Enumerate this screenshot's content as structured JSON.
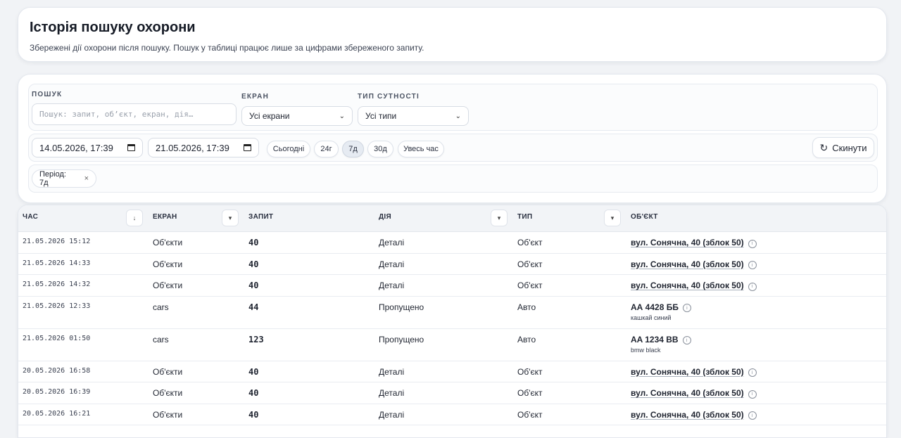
{
  "header": {
    "title": "Історія пошуку охорони",
    "subtitle": "Збережені дії охорони після пошуку. Пошук у таблиці працює лише за цифрами збереженого запиту."
  },
  "filters": {
    "search_label": "ПОШУК",
    "search_placeholder": "Пошук: запит, об’єкт, екран, дія…",
    "screen_label": "ЕКРАН",
    "screen_value": "Усі екрани",
    "type_label": "ТИП СУТНОСТІ",
    "type_value": "Усі типи",
    "date_from": "14.05.2026, 17:39",
    "date_to": "21.05.2026, 17:39",
    "chips": [
      "Сьогодні",
      "24г",
      "7д",
      "30д",
      "Увесь час"
    ],
    "active_chip": "7д",
    "reset_label": "Скинути",
    "period_chip": "Період: 7д"
  },
  "table": {
    "columns": [
      "ЧАС",
      "ЕКРАН",
      "ЗАПИТ",
      "ДІЯ",
      "ТИП",
      "ОБ'ЄКТ"
    ],
    "rows": [
      {
        "time": "21.05.2026 15:12",
        "screen": "Об'єкти",
        "query": "40",
        "action": "Деталі",
        "type": "Об'єкт",
        "object": "вул. Сонячна, 40 (зблок 50)",
        "sub": ""
      },
      {
        "time": "21.05.2026 14:33",
        "screen": "Об'єкти",
        "query": "40",
        "action": "Деталі",
        "type": "Об'єкт",
        "object": "вул. Сонячна, 40 (зблок 50)",
        "sub": ""
      },
      {
        "time": "21.05.2026 14:32",
        "screen": "Об'єкти",
        "query": "40",
        "action": "Деталі",
        "type": "Об'єкт",
        "object": "вул. Сонячна, 40 (зблок 50)",
        "sub": ""
      },
      {
        "time": "21.05.2026 12:33",
        "screen": "cars",
        "query": "44",
        "action": "Пропущено",
        "type": "Авто",
        "object": "АА 4428 ББ",
        "sub": "кашкай синий"
      },
      {
        "time": "21.05.2026 01:50",
        "screen": "cars",
        "query": "123",
        "action": "Пропущено",
        "type": "Авто",
        "object": "AA 1234 BB",
        "sub": "bmw black"
      },
      {
        "time": "20.05.2026 16:58",
        "screen": "Об'єкти",
        "query": "40",
        "action": "Деталі",
        "type": "Об'єкт",
        "object": "вул. Сонячна, 40 (зблок 50)",
        "sub": ""
      },
      {
        "time": "20.05.2026 16:39",
        "screen": "Об'єкти",
        "query": "40",
        "action": "Деталі",
        "type": "Об'єкт",
        "object": "вул. Сонячна, 40 (зблок 50)",
        "sub": ""
      },
      {
        "time": "20.05.2026 16:21",
        "screen": "Об'єкти",
        "query": "40",
        "action": "Деталі",
        "type": "Об'єкт",
        "object": "вул. Сонячна, 40 (зблок 50)",
        "sub": ""
      }
    ]
  }
}
